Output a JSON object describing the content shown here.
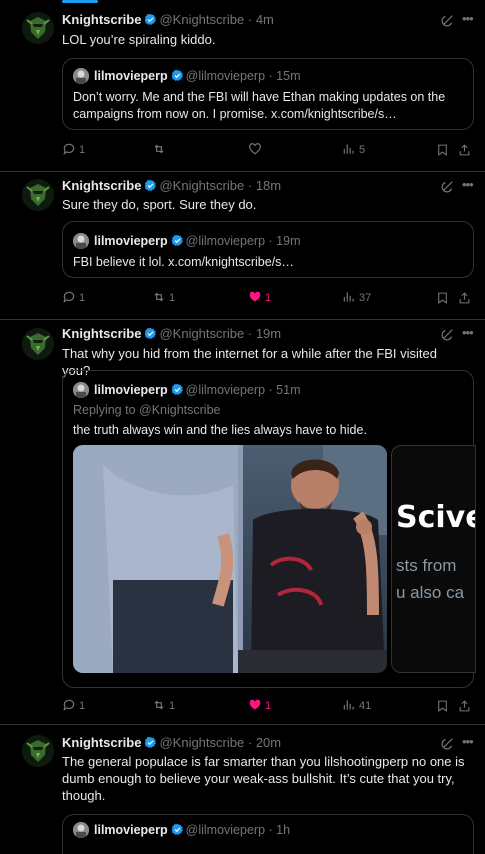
{
  "colors": {
    "accent": "#1d9bf0",
    "like": "#f91880",
    "muted": "#71767b",
    "border": "#2f3336"
  },
  "tweets": [
    {
      "author": "Knightscribe",
      "handle": "@Knightscribe",
      "sep": "·",
      "time": "4m",
      "text": "LOL you’re spiraling kiddo.",
      "quote": {
        "author": "lilmovieperp",
        "handle": "@lilmovieperp",
        "sep": "·",
        "time": "15m",
        "text": "Don’t worry. Me and the FBI will have Ethan making updates on the campaigns from now on. I promise. x.com/knightscribe/s…"
      },
      "stats": {
        "replies": "1",
        "reposts": "",
        "likes": "",
        "views": "5"
      }
    },
    {
      "author": "Knightscribe",
      "handle": "@Knightscribe",
      "sep": "·",
      "time": "18m",
      "text": "Sure they do, sport. Sure they do.",
      "quote": {
        "author": "lilmovieperp",
        "handle": "@lilmovieperp",
        "sep": "·",
        "time": "19m",
        "text": "FBI believe it lol. x.com/knightscribe/s…"
      },
      "stats": {
        "replies": "1",
        "reposts": "1",
        "likes": "1",
        "views": "37"
      }
    },
    {
      "author": "Knightscribe",
      "handle": "@Knightscribe",
      "sep": "·",
      "time": "19m",
      "text": "That why you hid from the internet for a while after the FBI visited you?",
      "quote": {
        "author": "lilmovieperp",
        "handle": "@lilmovieperp",
        "sep": "·",
        "time": "51m",
        "reply_to": "Replying to @Knightscribe",
        "text": "the truth always win and the lies always have to hide.",
        "image2_big": "Scivel",
        "image2_line1": "sts from",
        "image2_line2": "u also ca"
      },
      "stats": {
        "replies": "1",
        "reposts": "1",
        "likes": "1",
        "views": "41"
      }
    },
    {
      "author": "Knightscribe",
      "handle": "@Knightscribe",
      "sep": "·",
      "time": "20m",
      "text": "The general populace is far smarter than you lilshootingperp no one is dumb enough to believe your weak-ass bullshit. It’s cute that you try, though.",
      "quote": {
        "author": "lilmovieperp",
        "handle": "@lilmovieperp",
        "sep": "·",
        "time": "1h"
      }
    }
  ]
}
